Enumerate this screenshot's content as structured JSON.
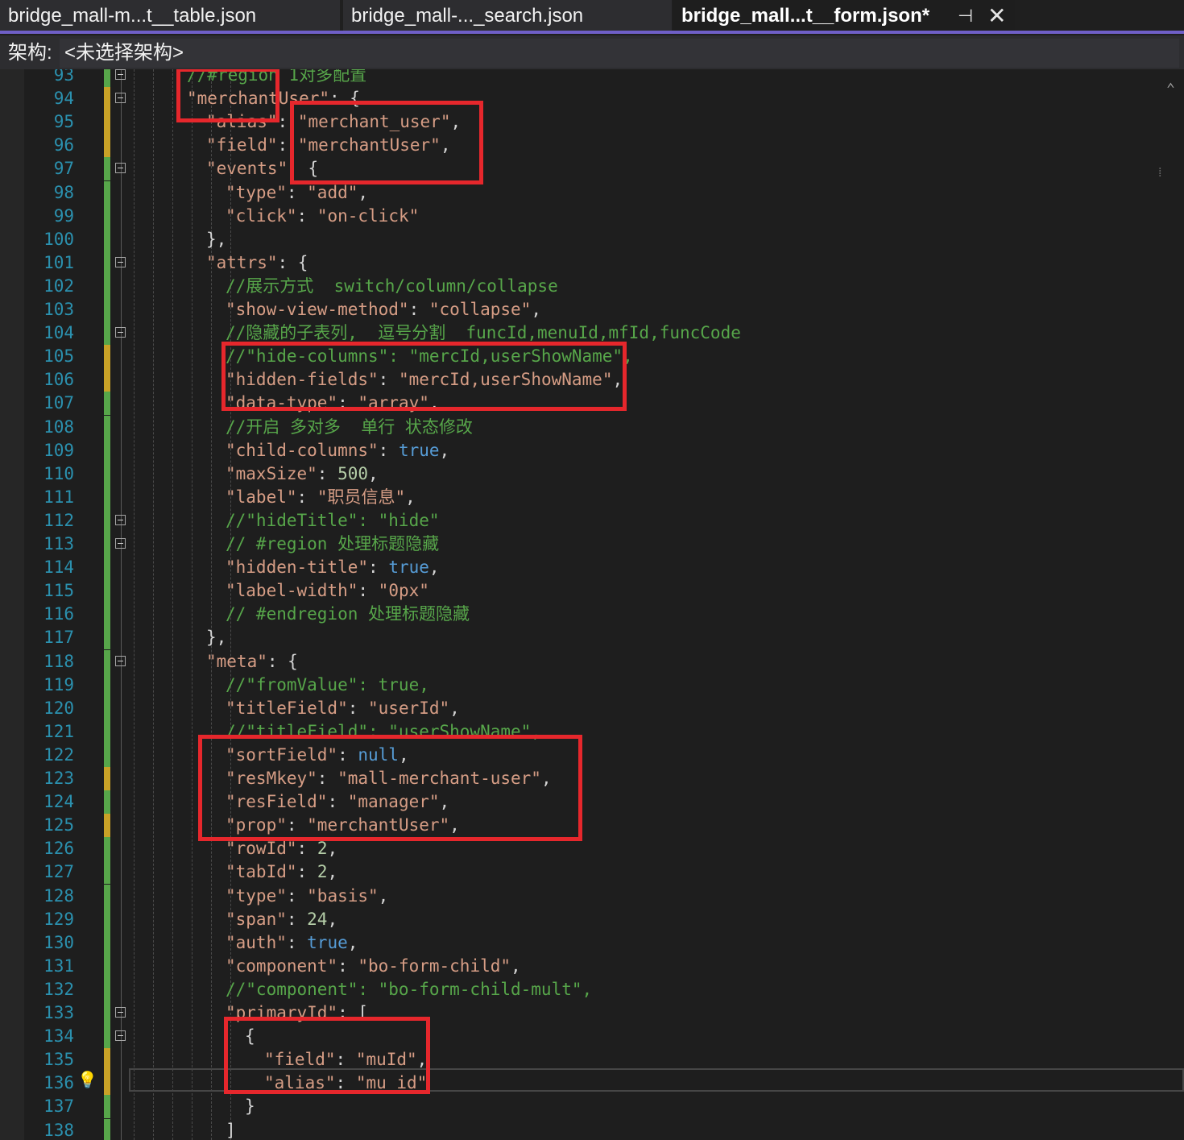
{
  "tabs": [
    {
      "label": "bridge_mall-m...t__table.json",
      "active": false
    },
    {
      "label": "bridge_mall-..._search.json",
      "active": false
    },
    {
      "label": "bridge_mall...t__form.json*",
      "active": true
    }
  ],
  "tab_pin_icon": "pin-icon",
  "tab_close_icon": "close-icon",
  "schema": {
    "label": "架构:",
    "value": "<未选择架构>"
  },
  "editor": {
    "lines": [
      {
        "n": 93,
        "change": "green",
        "fold": true,
        "indent": 3,
        "tokens": [
          [
            "c",
            "//#region 1对多配置"
          ]
        ]
      },
      {
        "n": 94,
        "change": "yellow",
        "fold": true,
        "indent": 3,
        "tokens": [
          [
            "k",
            "\"merchantUser\""
          ],
          [
            "p",
            ": {"
          ]
        ]
      },
      {
        "n": 95,
        "change": "yellow",
        "fold": false,
        "indent": 4,
        "tokens": [
          [
            "k",
            "\"alias\""
          ],
          [
            "p",
            ": "
          ],
          [
            "s",
            "\"merchant_user\""
          ],
          [
            "p",
            ","
          ]
        ]
      },
      {
        "n": 96,
        "change": "yellow",
        "fold": false,
        "indent": 4,
        "tokens": [
          [
            "k",
            "\"field\""
          ],
          [
            "p",
            ": "
          ],
          [
            "s",
            "\"merchantUser\""
          ],
          [
            "p",
            ","
          ]
        ]
      },
      {
        "n": 97,
        "change": "green",
        "fold": true,
        "indent": 4,
        "tokens": [
          [
            "k",
            "\"events\""
          ],
          [
            "p",
            ": {"
          ]
        ]
      },
      {
        "n": 98,
        "change": "green",
        "fold": false,
        "indent": 5,
        "tokens": [
          [
            "k",
            "\"type\""
          ],
          [
            "p",
            ": "
          ],
          [
            "s",
            "\"add\""
          ],
          [
            "p",
            ","
          ]
        ]
      },
      {
        "n": 99,
        "change": "green",
        "fold": false,
        "indent": 5,
        "tokens": [
          [
            "k",
            "\"click\""
          ],
          [
            "p",
            ": "
          ],
          [
            "s",
            "\"on-click\""
          ]
        ]
      },
      {
        "n": 100,
        "change": "green",
        "fold": false,
        "indent": 4,
        "tokens": [
          [
            "p",
            "},"
          ]
        ]
      },
      {
        "n": 101,
        "change": "green",
        "fold": true,
        "indent": 4,
        "tokens": [
          [
            "k",
            "\"attrs\""
          ],
          [
            "p",
            ": {"
          ]
        ]
      },
      {
        "n": 102,
        "change": "green",
        "fold": false,
        "indent": 5,
        "tokens": [
          [
            "c",
            "//展示方式  switch/column/collapse"
          ]
        ]
      },
      {
        "n": 103,
        "change": "green",
        "fold": false,
        "indent": 5,
        "tokens": [
          [
            "k",
            "\"show-view-method\""
          ],
          [
            "p",
            ": "
          ],
          [
            "s",
            "\"collapse\""
          ],
          [
            "p",
            ","
          ]
        ]
      },
      {
        "n": 104,
        "change": "green",
        "fold": true,
        "indent": 5,
        "tokens": [
          [
            "c",
            "//隐藏的子表列,  逗号分割  funcId,menuId,mfId,funcCode"
          ]
        ]
      },
      {
        "n": 105,
        "change": "yellow",
        "fold": false,
        "indent": 5,
        "tokens": [
          [
            "c",
            "//\"hide-columns\": \"mercId,userShowName\","
          ]
        ]
      },
      {
        "n": 106,
        "change": "yellow",
        "fold": false,
        "indent": 5,
        "tokens": [
          [
            "k",
            "\"hidden-fields\""
          ],
          [
            "p",
            ": "
          ],
          [
            "s",
            "\"mercId,userShowName\""
          ],
          [
            "p",
            ","
          ]
        ]
      },
      {
        "n": 107,
        "change": "green",
        "fold": false,
        "indent": 5,
        "tokens": [
          [
            "k",
            "\"data-type\""
          ],
          [
            "p",
            ": "
          ],
          [
            "s",
            "\"array\""
          ],
          [
            "p",
            ","
          ]
        ]
      },
      {
        "n": 108,
        "change": "green",
        "fold": false,
        "indent": 5,
        "tokens": [
          [
            "c",
            "//开启 多对多  单行 状态修改"
          ]
        ]
      },
      {
        "n": 109,
        "change": "green",
        "fold": false,
        "indent": 5,
        "tokens": [
          [
            "k",
            "\"child-columns\""
          ],
          [
            "p",
            ": "
          ],
          [
            "kw",
            "true"
          ],
          [
            "p",
            ","
          ]
        ]
      },
      {
        "n": 110,
        "change": "green",
        "fold": false,
        "indent": 5,
        "tokens": [
          [
            "k",
            "\"maxSize\""
          ],
          [
            "p",
            ": "
          ],
          [
            "n",
            "500"
          ],
          [
            "p",
            ","
          ]
        ]
      },
      {
        "n": 111,
        "change": "green",
        "fold": false,
        "indent": 5,
        "tokens": [
          [
            "k",
            "\"label\""
          ],
          [
            "p",
            ": "
          ],
          [
            "s",
            "\"职员信息\""
          ],
          [
            "p",
            ","
          ]
        ]
      },
      {
        "n": 112,
        "change": "green",
        "fold": true,
        "indent": 5,
        "tokens": [
          [
            "c",
            "//\"hideTitle\": \"hide\""
          ]
        ]
      },
      {
        "n": 113,
        "change": "green",
        "fold": true,
        "indent": 5,
        "tokens": [
          [
            "c",
            "// #region 处理标题隐藏"
          ]
        ]
      },
      {
        "n": 114,
        "change": "green",
        "fold": false,
        "indent": 5,
        "tokens": [
          [
            "k",
            "\"hidden-title\""
          ],
          [
            "p",
            ": "
          ],
          [
            "kw",
            "true"
          ],
          [
            "p",
            ","
          ]
        ]
      },
      {
        "n": 115,
        "change": "green",
        "fold": false,
        "indent": 5,
        "tokens": [
          [
            "k",
            "\"label-width\""
          ],
          [
            "p",
            ": "
          ],
          [
            "s",
            "\"0px\""
          ]
        ]
      },
      {
        "n": 116,
        "change": "green",
        "fold": false,
        "indent": 5,
        "tokens": [
          [
            "c",
            "// #endregion 处理标题隐藏"
          ]
        ]
      },
      {
        "n": 117,
        "change": "green",
        "fold": false,
        "indent": 4,
        "tokens": [
          [
            "p",
            "},"
          ]
        ]
      },
      {
        "n": 118,
        "change": "green",
        "fold": true,
        "indent": 4,
        "tokens": [
          [
            "k",
            "\"meta\""
          ],
          [
            "p",
            ": {"
          ]
        ]
      },
      {
        "n": 119,
        "change": "green",
        "fold": false,
        "indent": 5,
        "tokens": [
          [
            "c",
            "//\"fromValue\": true,"
          ]
        ]
      },
      {
        "n": 120,
        "change": "green",
        "fold": false,
        "indent": 5,
        "tokens": [
          [
            "k",
            "\"titleField\""
          ],
          [
            "p",
            ": "
          ],
          [
            "s",
            "\"userId\""
          ],
          [
            "p",
            ","
          ]
        ]
      },
      {
        "n": 121,
        "change": "green",
        "fold": false,
        "indent": 5,
        "tokens": [
          [
            "c",
            "//\"titleField\": \"userShowName\","
          ]
        ]
      },
      {
        "n": 122,
        "change": "green",
        "fold": false,
        "indent": 5,
        "tokens": [
          [
            "k",
            "\"sortField\""
          ],
          [
            "p",
            ": "
          ],
          [
            "kw",
            "null"
          ],
          [
            "p",
            ","
          ]
        ]
      },
      {
        "n": 123,
        "change": "yellow",
        "fold": false,
        "indent": 5,
        "tokens": [
          [
            "k",
            "\"resMkey\""
          ],
          [
            "p",
            ": "
          ],
          [
            "s",
            "\"mall-merchant-user\""
          ],
          [
            "p",
            ","
          ]
        ]
      },
      {
        "n": 124,
        "change": "green",
        "fold": false,
        "indent": 5,
        "tokens": [
          [
            "k",
            "\"resField\""
          ],
          [
            "p",
            ": "
          ],
          [
            "s",
            "\"manager\""
          ],
          [
            "p",
            ","
          ]
        ]
      },
      {
        "n": 125,
        "change": "yellow",
        "fold": false,
        "indent": 5,
        "tokens": [
          [
            "k",
            "\"prop\""
          ],
          [
            "p",
            ": "
          ],
          [
            "s",
            "\"merchantUser\""
          ],
          [
            "p",
            ","
          ]
        ]
      },
      {
        "n": 126,
        "change": "green",
        "fold": false,
        "indent": 5,
        "tokens": [
          [
            "k",
            "\"rowId\""
          ],
          [
            "p",
            ": "
          ],
          [
            "n",
            "2"
          ],
          [
            "p",
            ","
          ]
        ]
      },
      {
        "n": 127,
        "change": "green",
        "fold": false,
        "indent": 5,
        "tokens": [
          [
            "k",
            "\"tabId\""
          ],
          [
            "p",
            ": "
          ],
          [
            "n",
            "2"
          ],
          [
            "p",
            ","
          ]
        ]
      },
      {
        "n": 128,
        "change": "green",
        "fold": false,
        "indent": 5,
        "tokens": [
          [
            "k",
            "\"type\""
          ],
          [
            "p",
            ": "
          ],
          [
            "s",
            "\"basis\""
          ],
          [
            "p",
            ","
          ]
        ]
      },
      {
        "n": 129,
        "change": "green",
        "fold": false,
        "indent": 5,
        "tokens": [
          [
            "k",
            "\"span\""
          ],
          [
            "p",
            ": "
          ],
          [
            "n",
            "24"
          ],
          [
            "p",
            ","
          ]
        ]
      },
      {
        "n": 130,
        "change": "green",
        "fold": false,
        "indent": 5,
        "tokens": [
          [
            "k",
            "\"auth\""
          ],
          [
            "p",
            ": "
          ],
          [
            "kw",
            "true"
          ],
          [
            "p",
            ","
          ]
        ]
      },
      {
        "n": 131,
        "change": "green",
        "fold": false,
        "indent": 5,
        "tokens": [
          [
            "k",
            "\"component\""
          ],
          [
            "p",
            ": "
          ],
          [
            "s",
            "\"bo-form-child\""
          ],
          [
            "p",
            ","
          ]
        ]
      },
      {
        "n": 132,
        "change": "green",
        "fold": false,
        "indent": 5,
        "tokens": [
          [
            "c",
            "//\"component\": \"bo-form-child-mult\","
          ]
        ]
      },
      {
        "n": 133,
        "change": "green",
        "fold": true,
        "indent": 5,
        "tokens": [
          [
            "k",
            "\"primaryId\""
          ],
          [
            "p",
            ": ["
          ]
        ]
      },
      {
        "n": 134,
        "change": "green",
        "fold": true,
        "indent": 6,
        "tokens": [
          [
            "p",
            "{"
          ]
        ]
      },
      {
        "n": 135,
        "change": "yellow",
        "fold": false,
        "indent": 7,
        "tokens": [
          [
            "k",
            "\"field\""
          ],
          [
            "p",
            ": "
          ],
          [
            "s",
            "\"muId\""
          ],
          [
            "p",
            ","
          ]
        ]
      },
      {
        "n": 136,
        "change": "yellow",
        "fold": false,
        "indent": 7,
        "tokens": [
          [
            "k",
            "\"alias\""
          ],
          [
            "p",
            ": "
          ],
          [
            "s",
            "\"mu_id\""
          ]
        ]
      },
      {
        "n": 137,
        "change": "green",
        "fold": false,
        "indent": 6,
        "tokens": [
          [
            "p",
            "}"
          ]
        ]
      },
      {
        "n": 138,
        "change": "green",
        "fold": false,
        "indent": 5,
        "tokens": [
          [
            "p",
            "]"
          ]
        ]
      }
    ]
  },
  "colors": {
    "change_green": "#57a64a",
    "change_yellow": "#c9a227",
    "highlight_box": "#e6272c"
  },
  "lightbulb_icon": "lightbulb-icon"
}
